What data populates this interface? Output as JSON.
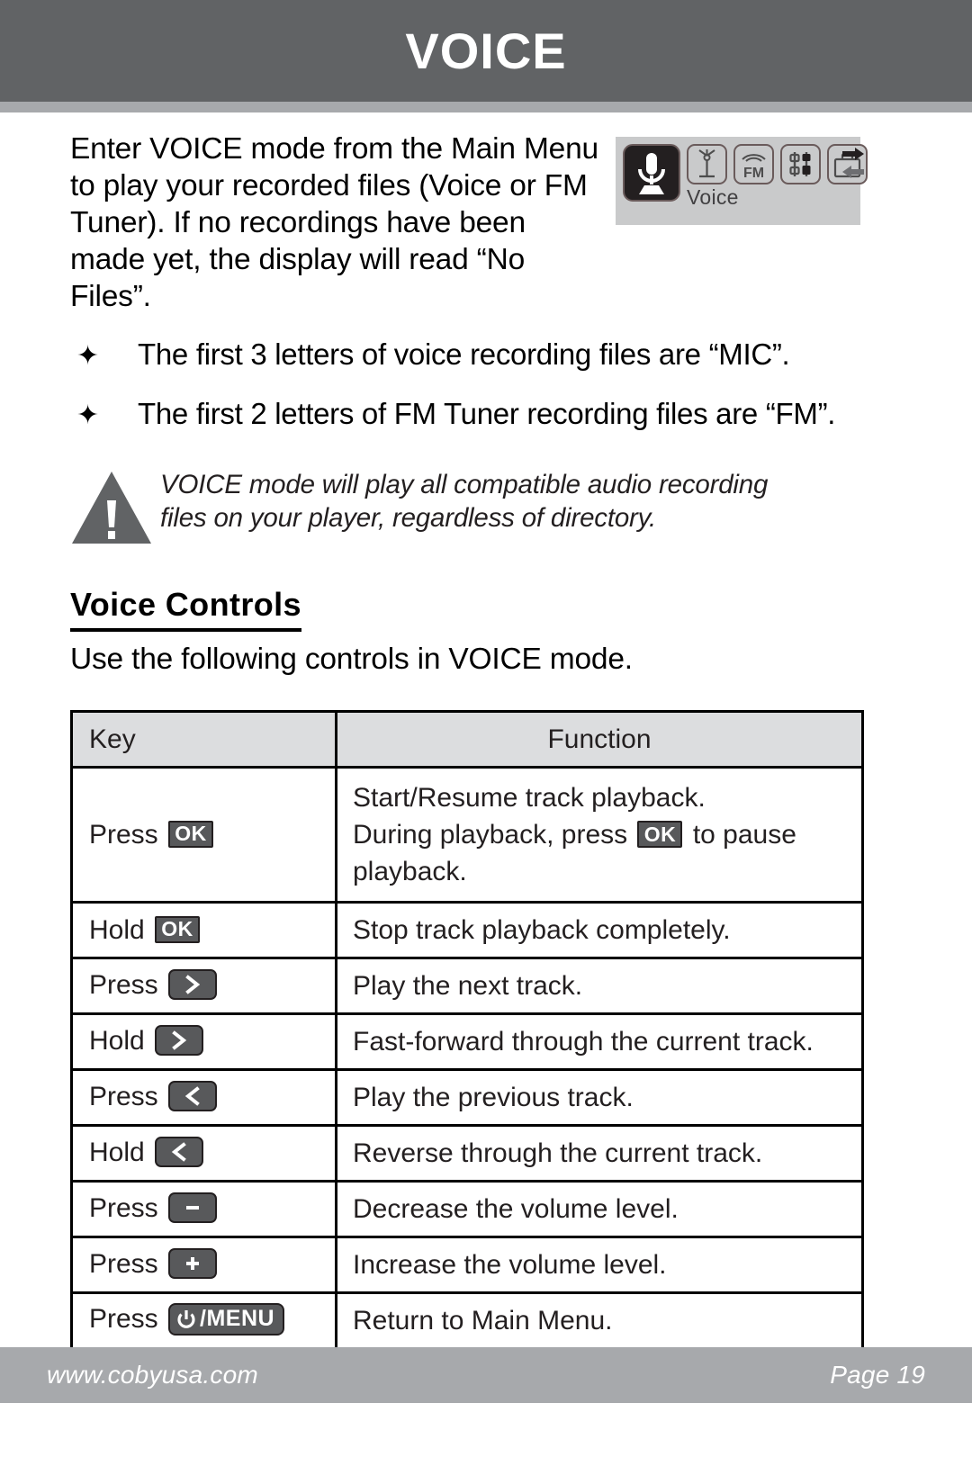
{
  "header": {
    "title": "VOICE"
  },
  "intro": {
    "paragraph": "Enter VOICE mode from the Main Menu to play your recorded files (Voice or FM Tuner). If no recordings have been made yet, the display will read “No Files”."
  },
  "device_menu": {
    "active_label": "Voice",
    "icons": [
      "microphone-icon",
      "fm-antenna-icon",
      "fm-radio-icon",
      "settings-sliders-icon",
      "briefcase-icon"
    ],
    "scroll_arrows": "right-left-arrows-icon",
    "strip_bg": "#c9cacb",
    "active_tile_bg": "#231f20"
  },
  "bullets": {
    "marker": "✦",
    "items": [
      "The first 3 letters of voice recording files are “MIC”.",
      "The first 2 letters of FM Tuner recording files are “FM”."
    ]
  },
  "note": {
    "icon": "warning-triangle-icon",
    "line1": "VOICE mode will play all compatible audio recording",
    "line2": "files on your player, regardless of directory."
  },
  "section": {
    "heading": "Voice Controls",
    "subtext": "Use the following controls in VOICE mode."
  },
  "table": {
    "headers": {
      "key": "Key",
      "function": "Function"
    },
    "rows": [
      {
        "key_action": "Press",
        "key_badge": "OK",
        "badge_type": "ok",
        "function_lines": [
          "Start/Resume track playback.",
          "During playback, press ",
          "playback."
        ],
        "inline_badge": "OK",
        "inline_tail": " to pause",
        "multiline": true
      },
      {
        "key_action": "Hold",
        "key_badge": "OK",
        "badge_type": "ok",
        "function": "Stop track playback completely."
      },
      {
        "key_action": "Press",
        "key_badge": "next",
        "badge_type": "chevron-right",
        "function": "Play the next track."
      },
      {
        "key_action": "Hold",
        "key_badge": "next",
        "badge_type": "chevron-right",
        "function": "Fast-forward through the current track."
      },
      {
        "key_action": "Press",
        "key_badge": "previous",
        "badge_type": "chevron-left",
        "function": "Play the previous track."
      },
      {
        "key_action": "Hold",
        "key_badge": "previous",
        "badge_type": "chevron-left",
        "function": "Reverse through the current track."
      },
      {
        "key_action": "Press",
        "key_badge": "minus",
        "badge_type": "minus",
        "function": "Decrease the volume level."
      },
      {
        "key_action": "Press",
        "key_badge": "plus",
        "badge_type": "plus",
        "function": "Increase the volume level."
      },
      {
        "key_action": "Press",
        "key_badge": "/MENU",
        "badge_type": "power-menu",
        "function": "Return to Main Menu."
      }
    ]
  },
  "footer": {
    "website": "www.cobyusa.com",
    "page": "Page 19"
  },
  "colors": {
    "header_bg": "#616365",
    "accent_bar": "#a7a9ac",
    "table_header_bg": "#dcdddf",
    "badge_bg": "#58595b",
    "badge_border": "#231f20",
    "text": "#000000"
  }
}
